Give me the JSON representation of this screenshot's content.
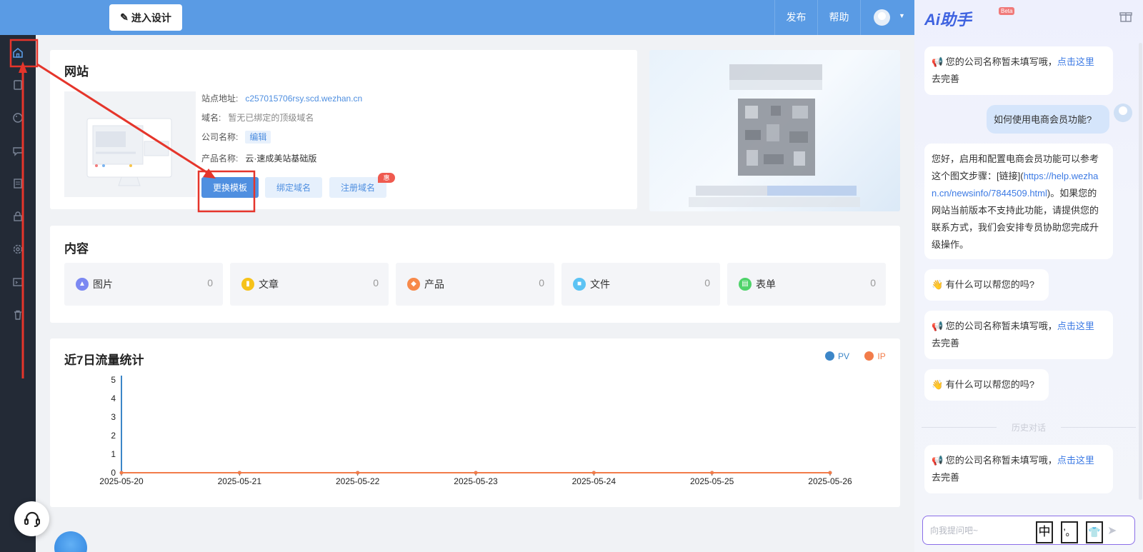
{
  "topbar": {
    "design_button": "进入设计",
    "publish": "发布",
    "help": "帮助"
  },
  "sidebar": {
    "items": [
      "home-icon",
      "page-icon",
      "palette-icon",
      "chat-icon",
      "list-icon",
      "lock-icon",
      "settings-icon",
      "code-icon",
      "trash-icon"
    ]
  },
  "website": {
    "title": "网站",
    "site_address_label": "站点地址:",
    "site_address_value": "c257015706rsy.scd.wezhan.cn",
    "domain_label": "域名:",
    "domain_value": "暂无已绑定的顶级域名",
    "company_label": "公司名称:",
    "company_edit": "编辑",
    "product_label": "产品名称:",
    "product_value": "云·速成美站基础版",
    "change_template": "更换模板",
    "bind_domain": "绑定域名",
    "register_domain": "注册域名",
    "promo_badge": "惠"
  },
  "content": {
    "title": "内容",
    "tiles": [
      {
        "label": "图片",
        "count": "0",
        "color": "#7b88f2",
        "icon": "image-icon"
      },
      {
        "label": "文章",
        "count": "0",
        "color": "#f6c21a",
        "icon": "article-icon"
      },
      {
        "label": "产品",
        "count": "0",
        "color": "#f7894a",
        "icon": "product-icon"
      },
      {
        "label": "文件",
        "count": "0",
        "color": "#5cc3f4",
        "icon": "folder-icon"
      },
      {
        "label": "表单",
        "count": "0",
        "color": "#4fd36a",
        "icon": "form-icon"
      }
    ]
  },
  "traffic": {
    "title": "近7日流量统计"
  },
  "chart_data": {
    "type": "line",
    "x": [
      "2025-05-20",
      "2025-05-21",
      "2025-05-22",
      "2025-05-23",
      "2025-05-24",
      "2025-05-25",
      "2025-05-26"
    ],
    "series": [
      {
        "name": "PV",
        "values": [
          0,
          0,
          0,
          0,
          0,
          0,
          0
        ],
        "color": "#3c86c8"
      },
      {
        "name": "IP",
        "values": [
          0,
          0,
          0,
          0,
          0,
          0,
          0
        ],
        "color": "#f27c4a"
      }
    ],
    "ylim": [
      0,
      5
    ],
    "yticks": [
      "0",
      "1",
      "2",
      "3",
      "4",
      "5"
    ],
    "legend": "top-right",
    "grid": false
  },
  "ai": {
    "title": "Ai助手",
    "beta": "Beta",
    "msg1_text": "📢 您的公司名称暂未填写哦，",
    "msg1_link": "点击这里",
    "msg1_tail": "去完善",
    "user_msg": "如何使用电商会员功能?",
    "reply_part1": "您好，启用和配置电商会员功能可以参考这个图文步骤：[链接](",
    "reply_link": "https://help.wezhan.cn/newsinfo/7844509.html",
    "reply_part2": ")。如果您的网站当前版本不支持此功能，请提供您的联系方式，我们会安排专员协助您完成升级操作。",
    "help_msg": "👋 有什么可以帮您的吗?",
    "history_label": "历史对话",
    "input_placeholder": "向我提问吧~"
  },
  "ime": {
    "keys": [
      "中",
      "’。",
      "👕"
    ]
  }
}
